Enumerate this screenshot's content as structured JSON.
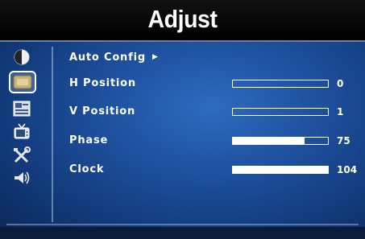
{
  "header": {
    "title": "Adjust"
  },
  "sidebar": {
    "icons": [
      {
        "name": "brightness-contrast-icon",
        "selected": false
      },
      {
        "name": "adjust-screen-icon",
        "selected": true
      },
      {
        "name": "image-settings-icon",
        "selected": false
      },
      {
        "name": "tv-icon",
        "selected": false
      },
      {
        "name": "tools-icon",
        "selected": false
      },
      {
        "name": "audio-icon",
        "selected": false
      }
    ]
  },
  "menu": {
    "auto_config": {
      "label": "Auto Config",
      "arrow": "▶"
    },
    "items": [
      {
        "label": "H Position",
        "value": "0",
        "level": 0
      },
      {
        "label": "V Position",
        "value": "1",
        "level": 0
      },
      {
        "label": "Phase",
        "value": "75",
        "level": 0.75
      },
      {
        "label": "Clock",
        "value": "104",
        "level": 1.0
      }
    ]
  },
  "colors": {
    "background": "#1d4f9c",
    "title_bar": "#000000",
    "text": "#ffffff"
  }
}
